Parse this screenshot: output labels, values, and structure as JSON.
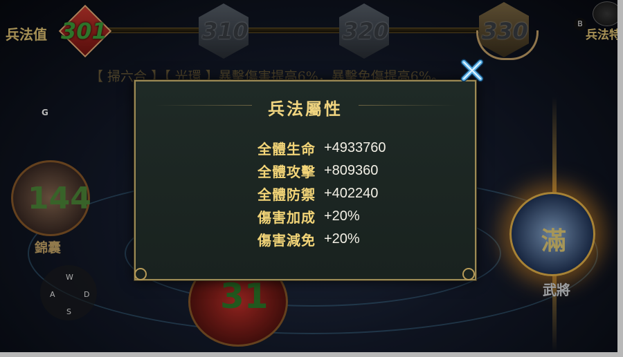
{
  "top_bar": {
    "value_label": "兵法值",
    "current_value": "301",
    "milestones": [
      "310",
      "320",
      "330"
    ],
    "feature_label": "兵法特",
    "feature_key": "B"
  },
  "background": {
    "bonus_text": "【 掃六合 】【 光環 】暴擊傷害提高6%，暴擊免傷提高6%。",
    "left_orb": {
      "value": "144",
      "label": "錦囊"
    },
    "bottom_orb": {
      "value": "31"
    },
    "right_orb": {
      "value": "滿",
      "label": "武將"
    }
  },
  "controls": {
    "g_key": "G",
    "dpad": {
      "up": "W",
      "left": "A",
      "right": "D",
      "down": "S"
    }
  },
  "dialog": {
    "title": "兵法屬性",
    "stats": [
      {
        "label": "全體生命",
        "value": "+4933760"
      },
      {
        "label": "全體攻擊",
        "value": "+809360"
      },
      {
        "label": "全體防禦",
        "value": "+402240"
      },
      {
        "label": "傷害加成",
        "value": "+20%"
      },
      {
        "label": "傷害減免",
        "value": "+20%"
      }
    ]
  },
  "colors": {
    "gold": "#f3d578",
    "close_accent": "#5fb3e8"
  },
  "icons": {
    "close": "close-x-icon",
    "feature": "scroll-icon"
  }
}
